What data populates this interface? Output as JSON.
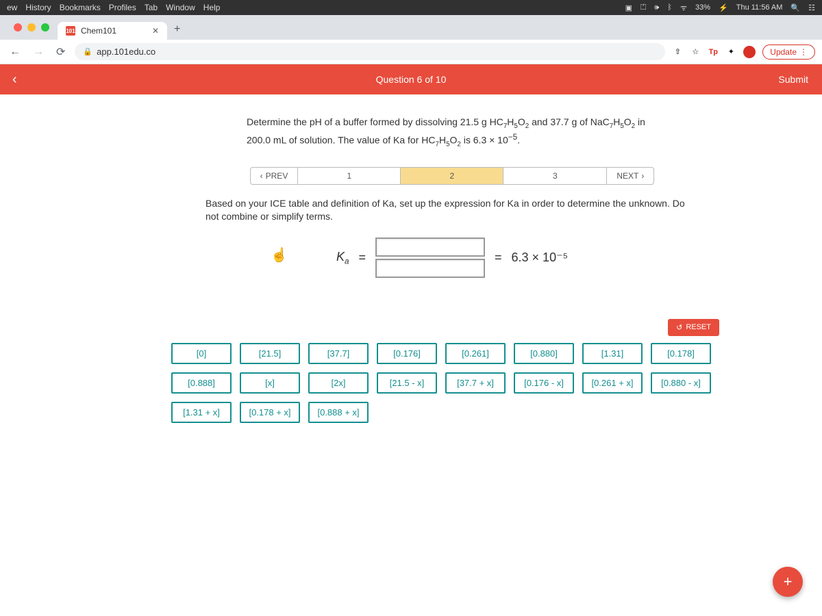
{
  "mac_menu": {
    "left": [
      "ew",
      "History",
      "Bookmarks",
      "Profiles",
      "Tab",
      "Window",
      "Help"
    ],
    "battery": "33%",
    "clock": "Thu 11:56 AM"
  },
  "browser": {
    "tab_title": "Chem101",
    "tab_favicon": "101",
    "url": "app.101edu.co",
    "update_label": "Update"
  },
  "app": {
    "header_title": "Question 6 of 10",
    "submit_label": "Submit",
    "prompt_html": "Determine the pH of a buffer formed by dissolving 21.5 g HC<sub>7</sub>H<sub>5</sub>O<sub>2</sub> and 37.7 g of NaC<sub>7</sub>H<sub>5</sub>O<sub>2</sub> in 200.0 mL of solution. The value of Ka for HC<sub>7</sub>H<sub>5</sub>O<sub>2</sub> is 6.3 × 10<sup>−5</sup>.",
    "steps": {
      "prev": "PREV",
      "next": "NEXT",
      "cells": [
        "1",
        "2",
        "3"
      ],
      "active_index": 1
    },
    "instruction": "Based on your ICE table and definition of Ka, set up the expression for Ka in order to determine the unknown. Do not combine or simplify terms.",
    "equation": {
      "lhs": "Ka",
      "eq": "=",
      "result": "6.3 × 10⁻⁵"
    },
    "reset_label": "RESET",
    "tiles": [
      "[0]",
      "[21.5]",
      "[37.7]",
      "[0.176]",
      "[0.261]",
      "[0.880]",
      "[1.31]",
      "[0.178]",
      "[0.888]",
      "[x]",
      "[2x]",
      "[21.5 - x]",
      "[37.7 + x]",
      "[0.176 - x]",
      "[0.261 + x]",
      "[0.880 - x]",
      "[1.31 + x]",
      "[0.178 + x]",
      "[0.888 + x]"
    ]
  }
}
